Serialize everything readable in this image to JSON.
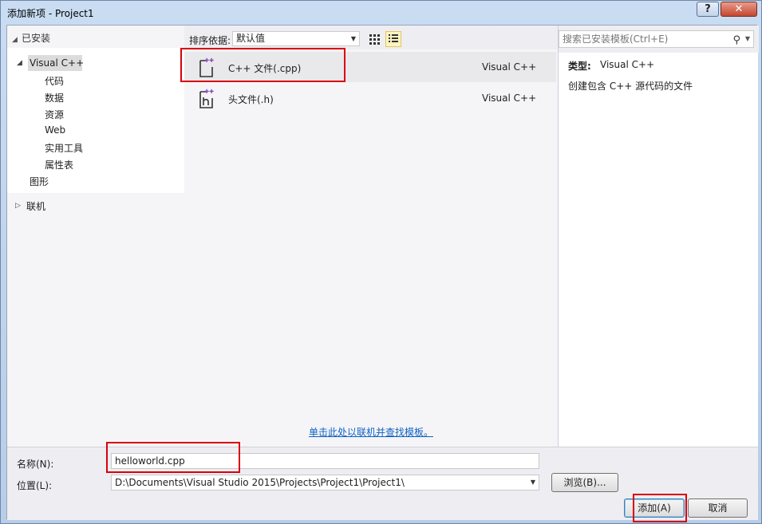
{
  "window": {
    "title": "添加新项 - Project1",
    "help_label": "?",
    "close_label": "✕"
  },
  "tree": {
    "installed_label": "已安装",
    "visual_cpp": "Visual C++",
    "children": [
      "代码",
      "数据",
      "资源",
      "Web",
      "实用工具",
      "属性表"
    ],
    "graphics": "图形",
    "online": "联机"
  },
  "toolbar": {
    "sort_label": "排序依据:",
    "sort_value": "默认值"
  },
  "templates": [
    {
      "name": "C++ 文件(.cpp)",
      "type": "Visual C++",
      "icon": "cpp-file-icon"
    },
    {
      "name": "头文件(.h)",
      "type": "Visual C++",
      "icon": "header-file-icon"
    }
  ],
  "online_link": "单击此处以联机并查找模板。",
  "search": {
    "placeholder": "搜索已安装模板(Ctrl+E)"
  },
  "details": {
    "type_label": "类型:",
    "type_value": "Visual C++",
    "description": "创建包含 C++ 源代码的文件"
  },
  "form": {
    "name_label": "名称(N):",
    "name_value": "helloworld.cpp",
    "location_label": "位置(L):",
    "location_value": "D:\\Documents\\Visual Studio 2015\\Projects\\Project1\\Project1\\",
    "browse_label": "浏览(B)...",
    "add_label": "添加(A)",
    "cancel_label": "取消"
  },
  "colors": {
    "highlight_box": "#d9000c",
    "link": "#1062c4",
    "icon_accent": "#8a3fb8"
  }
}
